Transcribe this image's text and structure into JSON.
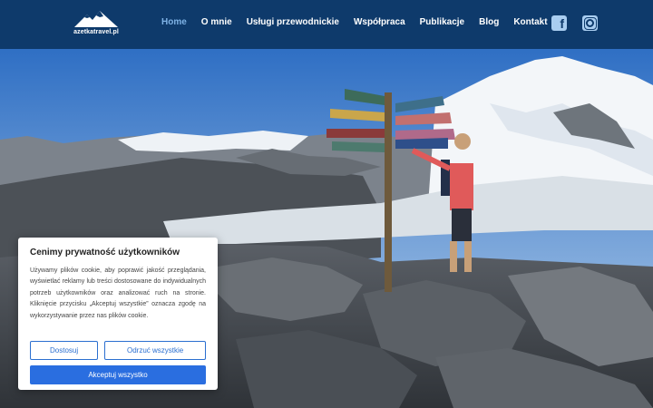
{
  "header": {
    "logo_text": "azetkatravel.pl",
    "nav": [
      {
        "label": "Home",
        "active": true
      },
      {
        "label": "O mnie",
        "active": false
      },
      {
        "label": "Usługi przewodnickie",
        "active": false
      },
      {
        "label": "Współpraca",
        "active": false
      },
      {
        "label": "Publikacje",
        "active": false
      },
      {
        "label": "Blog",
        "active": false
      },
      {
        "label": "Kontakt",
        "active": false
      }
    ],
    "social": [
      "facebook-icon",
      "instagram-icon"
    ]
  },
  "cookie": {
    "title": "Cenimy prywatność użytkowników",
    "text": "Używamy plików cookie, aby poprawić jakość przeglądania, wyświetlać reklamy lub treści dostosowane do indywidualnych potrzeb użytkowników oraz analizować ruch na stronie. Kliknięcie przycisku „Akceptuj wszystkie” oznacza zgodę na wykorzystywanie przez nas plików cookie.",
    "customize_label": "Dostosuj",
    "reject_label": "Odrzuć wszystkie",
    "accept_label": "Akceptuj wszystko"
  },
  "colors": {
    "header_bg": "#0e3a6b",
    "nav_active": "#7fb3e6",
    "accent": "#2a6ee0"
  }
}
